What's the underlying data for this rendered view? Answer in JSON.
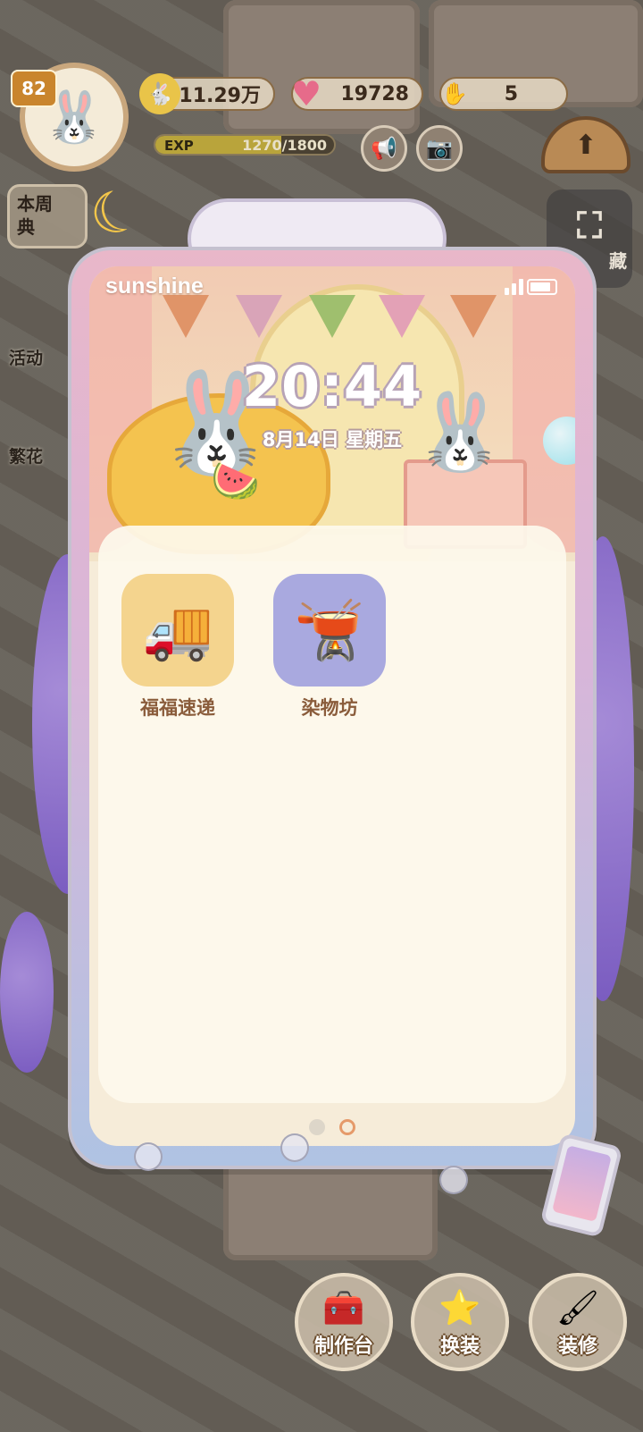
{
  "hud": {
    "level": "82",
    "coins": "11.29万",
    "hearts": "19728",
    "energy": "5",
    "exp_label": "EXP",
    "exp_value": "1270/1800",
    "exp_progress": 0.7056
  },
  "side_menu": {
    "weekly_label": "本周\n典",
    "event_label": "活动",
    "flower_label": "繁花",
    "collect_label": "藏"
  },
  "phone": {
    "carrier": "sunshine",
    "time": "20:44",
    "date": "8月14日 星期五",
    "apps": [
      {
        "label": "福福速递",
        "icon": "delivery-truck-icon",
        "bg": "#f4d48e"
      },
      {
        "label": "染物坊",
        "icon": "dye-cauldron-icon",
        "bg": "#a9a9df"
      }
    ],
    "pages": {
      "current": 2,
      "total": 2
    }
  },
  "bottom_bar": {
    "craft_label": "制作台",
    "dress_label": "换装",
    "decor_label": "装修"
  },
  "colors": {
    "accent": "#e59a6a",
    "app_label": "#8a5c3b"
  }
}
